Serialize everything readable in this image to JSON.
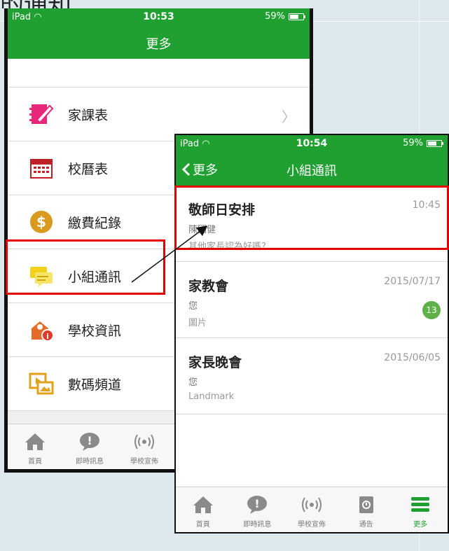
{
  "background_fragment": "的通知",
  "left_screen": {
    "status": {
      "carrier": "iPad",
      "time": "10:53",
      "battery": "59%"
    },
    "nav_title": "更多",
    "items": [
      {
        "label": "家課表",
        "icon": "homework-notebook-icon"
      },
      {
        "label": "校曆表",
        "icon": "calendar-icon"
      },
      {
        "label": "繳費紀錄",
        "icon": "dollar-coin-icon"
      },
      {
        "label": "小組通訊",
        "icon": "chat-bubbles-icon"
      },
      {
        "label": "學校資訊",
        "icon": "school-info-icon"
      },
      {
        "label": "數碼頻道",
        "icon": "digital-channel-icon"
      }
    ],
    "tabs": [
      {
        "label": "首頁",
        "icon": "home-icon"
      },
      {
        "label": "即時訊息",
        "icon": "message-icon"
      },
      {
        "label": "學校宣佈",
        "icon": "broadcast-icon"
      }
    ]
  },
  "right_screen": {
    "status": {
      "carrier": "iPad",
      "time": "10:54",
      "battery": "59%"
    },
    "back_label": "更多",
    "nav_title": "小組通訊",
    "conversations": [
      {
        "title": "敬師日安排",
        "time": "10:45",
        "sender": "陳國健",
        "preview": "其他家長認為好嗎？"
      },
      {
        "title": "家教會",
        "time": "2015/07/17",
        "sender": "您",
        "preview": "圖片",
        "badge": "13"
      },
      {
        "title": "家長晚會",
        "time": "2015/06/05",
        "sender": "您",
        "preview": "Landmark"
      }
    ],
    "tabs": [
      {
        "label": "首頁",
        "icon": "home-icon"
      },
      {
        "label": "即時訊息",
        "icon": "message-icon"
      },
      {
        "label": "學校宣佈",
        "icon": "broadcast-icon"
      },
      {
        "label": "通告",
        "icon": "notice-icon"
      },
      {
        "label": "更多",
        "icon": "more-icon"
      }
    ]
  },
  "colors": {
    "accent": "#1fa030",
    "highlight": "#e30000",
    "badge": "#5fb14a"
  }
}
